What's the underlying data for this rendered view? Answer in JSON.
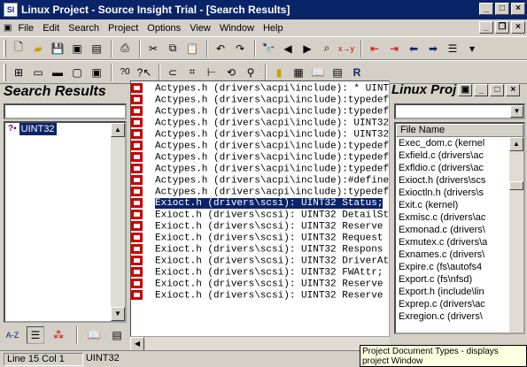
{
  "window": {
    "title": "Linux Project - Source Insight Trial - [Search Results]",
    "app_icon": "SI"
  },
  "menu": {
    "items": [
      "File",
      "Edit",
      "Search",
      "Project",
      "Options",
      "View",
      "Window",
      "Help"
    ]
  },
  "search_panel": {
    "title": "Search Results",
    "input_value": "",
    "items": [
      "UINT32"
    ],
    "bottom_tools": [
      "A-Z",
      "list-icon",
      "tree-icon",
      "book-icon",
      "window-icon"
    ]
  },
  "results": {
    "selected_index": 10,
    "rows": [
      "Actypes.h (drivers\\acpi\\include): * UINT32",
      "Actypes.h (drivers\\acpi\\include):typedef ur",
      "Actypes.h (drivers\\acpi\\include):typedef ur",
      "Actypes.h (drivers\\acpi\\include):  UINT32",
      "Actypes.h (drivers\\acpi\\include):  UINT32",
      "Actypes.h (drivers\\acpi\\include):typedef U",
      "Actypes.h (drivers\\acpi\\include):typedef U",
      "Actypes.h (drivers\\acpi\\include):typedef U",
      "Actypes.h (drivers\\acpi\\include):#define A",
      "Actypes.h (drivers\\acpi\\include):typedef U",
      "Exioct.h (drivers\\scsi):    UINT32   Status;",
      "Exioct.h (drivers\\scsi):    UINT32   DetailSt",
      "Exioct.h (drivers\\scsi):    UINT32   Reserve",
      "Exioct.h (drivers\\scsi):    UINT32   Request",
      "Exioct.h (drivers\\scsi):    UINT32   Respons",
      "Exioct.h (drivers\\scsi):    UINT32   DriverAt",
      "Exioct.h (drivers\\scsi):    UINT32   FWAttr;",
      "Exioct.h (drivers\\scsi):    UINT32   Reserve",
      "Exioct.h (drivers\\scsi):    UINT32   Reserve"
    ]
  },
  "project_panel": {
    "title": "Linux Proj",
    "column_header": "File Name",
    "files": [
      "Exec_dom.c (kernel",
      "Exfield.c (drivers\\ac",
      "Exfldio.c (drivers\\ac",
      "Exioct.h (drivers\\scs",
      "Exioctln.h (drivers\\s",
      "Exit.c (kernel)",
      "Exmisc.c (drivers\\ac",
      "Exmonad.c (drivers\\",
      "Exmutex.c (drivers\\a",
      "Exnames.c (drivers\\",
      "Expire.c (fs\\autofs4",
      "Export.c (fs\\nfsd)",
      "Export.h (include\\lin",
      "Exprep.c (drivers\\ac",
      "Exregion.c (drivers\\"
    ]
  },
  "status": {
    "position": "Line 15  Col 1",
    "symbol": "UINT32"
  },
  "tooltip": {
    "text": "Project Document Types - displays project Window"
  }
}
